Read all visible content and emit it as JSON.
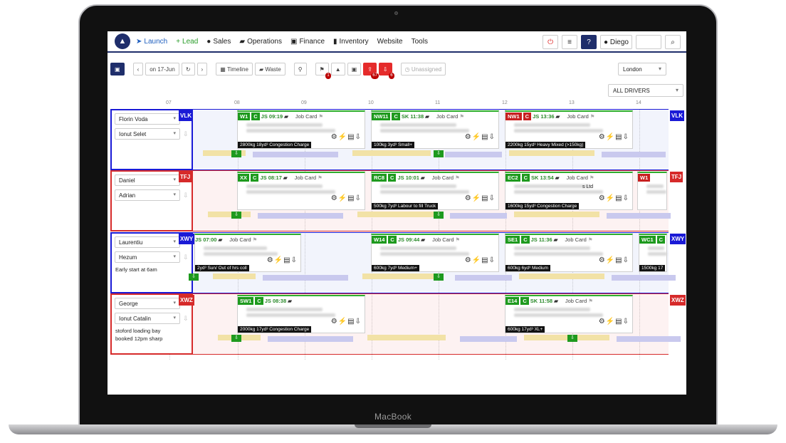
{
  "device_label": "MacBook",
  "nav": {
    "items": [
      {
        "label": "Launch",
        "icon": "rocket-icon"
      },
      {
        "label": "Lead",
        "icon": "plus-icon"
      },
      {
        "label": "Sales",
        "icon": "user-icon"
      },
      {
        "label": "Operations",
        "icon": "truck-icon"
      },
      {
        "label": "Finance",
        "icon": "money-icon"
      },
      {
        "label": "Inventory",
        "icon": "book-icon"
      },
      {
        "label": "Website"
      },
      {
        "label": "Tools"
      }
    ],
    "user": "Diego"
  },
  "toolbar": {
    "date": "on 17-Jun",
    "timeline": "Timeline",
    "waste": "Waste",
    "badge_1": "1",
    "badge_2": "67",
    "badge_3": "6",
    "unassigned": "Unassigned",
    "location": "London",
    "drivers": "ALL DRIVERS"
  },
  "hours": [
    "07",
    "08",
    "09",
    "10",
    "11",
    "12",
    "13",
    "14"
  ],
  "rows": [
    {
      "color": "#1a1ad6",
      "driver": "Florin Voda",
      "mate": "Ionut Selet",
      "vehicle": "VLK",
      "note_1": "",
      "note_2": "",
      "jobs": [
        {
          "code": "W1",
          "cs": "C",
          "time": "JS 09:19",
          "job": "Job Card",
          "strip": "2800kg 18yd³ Congestion Charge"
        },
        {
          "code": "NW11",
          "cs": "C",
          "time": "SK 11:38",
          "job": "Job Card",
          "strip": "100kg 3yd³ Small+"
        },
        {
          "code": "NW1",
          "cs": "C",
          "time": "JS 13:36",
          "job": "Job Card",
          "strip": "2200kg 15yd³ Heavy Mixed (>150kg)"
        }
      ]
    },
    {
      "color": "#d62a2a",
      "driver": "Daniel",
      "mate": "Adrian",
      "vehicle": "TFJ",
      "note_1": "",
      "note_2": "",
      "jobs": [
        {
          "code": "XX",
          "cs": "C",
          "time": "JS 08:17",
          "job": "Job Card",
          "strip": ""
        },
        {
          "code": "RC8",
          "cs": "C",
          "time": "JS 10:01",
          "job": "Job Card",
          "strip": "500kg 7yd³ Labour to fill Truck"
        },
        {
          "code": "EC2",
          "cs": "C",
          "time": "SK 13:54",
          "job": "Job Card",
          "strip": "1600kg 15yd³ Congestion Charge",
          "extra": "s Ltd"
        },
        {
          "code": "W1",
          "cs": "",
          "time": "",
          "job": "",
          "strip": ""
        }
      ]
    },
    {
      "color": "#1a1ad6",
      "driver": "Laurentiu",
      "mate": "Hezum",
      "vehicle": "XWY",
      "note_1": "Early start at 6am",
      "note_2": "",
      "jobs": [
        {
          "code": "",
          "cs": "",
          "time": "JS 07:00",
          "job": "Job Card",
          "strip": "2yd³ Sun/ Out of hrs coll"
        },
        {
          "code": "W14",
          "cs": "C",
          "time": "JS 09:44",
          "job": "Job Card",
          "strip": "600kg 7yd³ Medium+"
        },
        {
          "code": "SE1",
          "cs": "C",
          "time": "JS 11:36",
          "job": "Job Card",
          "strip": "600kg 6yd³ Medium"
        },
        {
          "code": "WC1",
          "cs": "C",
          "time": "",
          "job": "",
          "strip": "1500kg 17"
        }
      ]
    },
    {
      "color": "#d62a2a",
      "driver": "George",
      "mate": "Ionut Catalin",
      "vehicle": "XWZ",
      "note_1": "stoford loading bay",
      "note_2": "booked 12pm sharp",
      "jobs": [
        {
          "code": "SW1",
          "cs": "C",
          "time": "JS 08:38",
          "job": "",
          "strip": "2000kg 17yd³ Congestion Charge"
        },
        {
          "code": "E14",
          "cs": "C",
          "time": "SK 11:58",
          "job": "Job Card",
          "strip": "600kg 17yd³ XL+"
        }
      ]
    }
  ]
}
